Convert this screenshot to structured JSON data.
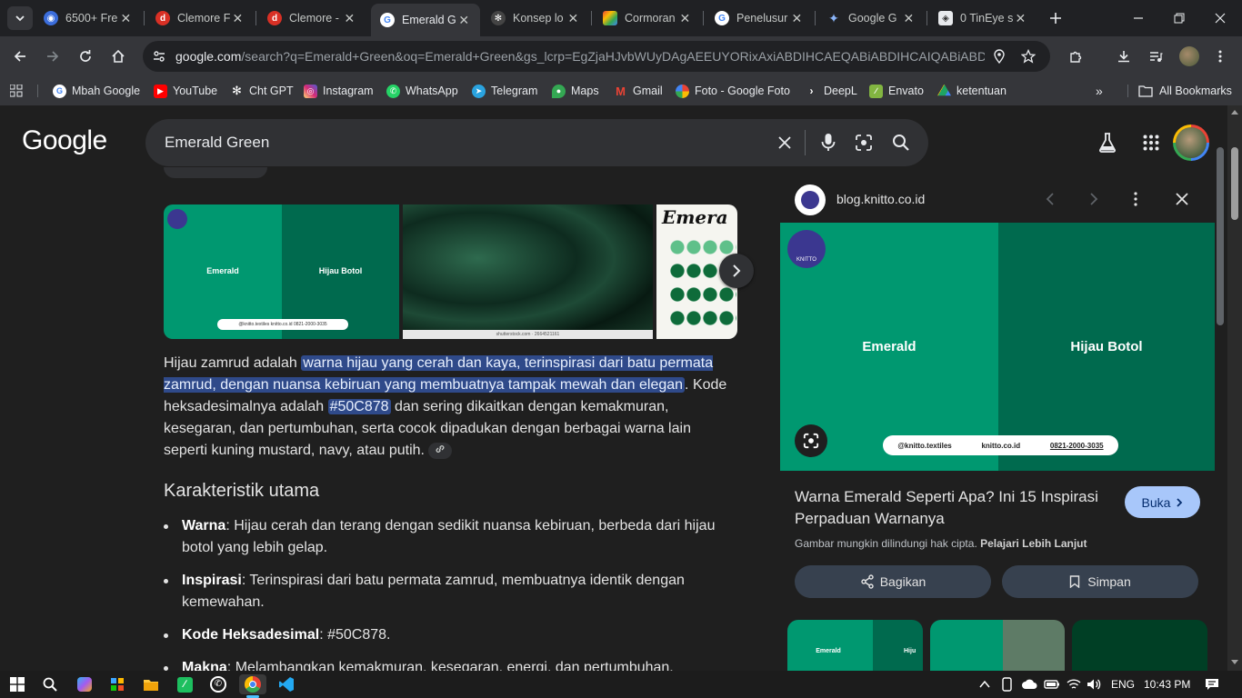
{
  "tabs": [
    {
      "title": "6500+ Fre",
      "favicon": "globe-blue-icon",
      "active": false
    },
    {
      "title": "Clemore F",
      "favicon": "d-red-icon",
      "active": false
    },
    {
      "title": "Clemore -",
      "favicon": "d-red-icon",
      "active": false
    },
    {
      "title": "Emerald G",
      "favicon": "google-icon",
      "active": true
    },
    {
      "title": "Konsep lo",
      "favicon": "chatgpt-icon",
      "active": false
    },
    {
      "title": "Cormoran",
      "favicon": "cormoran-icon",
      "active": false
    },
    {
      "title": "Penelusur",
      "favicon": "google-icon",
      "active": false
    },
    {
      "title": "Google G",
      "favicon": "gemini-icon",
      "active": false
    },
    {
      "title": "0 TinEye s",
      "favicon": "tineye-icon",
      "active": false
    }
  ],
  "omnibox": {
    "url_main": "google.com",
    "url_rest": "/search?q=Emerald+Green&oq=Emerald+Green&gs_lcrp=EgZjaHJvbWUyDAgAEEUYORixAxiABDIHCAEQABiABDIHCAIQABiABDIH..."
  },
  "bookmarks": [
    {
      "label": "Mbah Google",
      "icon": "google-icon",
      "color": "#4285f4"
    },
    {
      "label": "YouTube",
      "icon": "youtube-icon",
      "color": "#ff0000"
    },
    {
      "label": "Cht GPT",
      "icon": "chatgpt-icon",
      "color": "#10a37f"
    },
    {
      "label": "Instagram",
      "icon": "instagram-icon",
      "color": "#d6249f"
    },
    {
      "label": "WhatsApp",
      "icon": "whatsapp-icon",
      "color": "#25d366"
    },
    {
      "label": "Telegram",
      "icon": "telegram-icon",
      "color": "#2aa3df"
    },
    {
      "label": "Maps",
      "icon": "maps-icon",
      "color": "#34a853"
    },
    {
      "label": "Gmail",
      "icon": "gmail-icon",
      "color": "#ea4335"
    },
    {
      "label": "Foto - Google Foto",
      "icon": "photos-icon",
      "color": "#fbbc04"
    },
    {
      "label": "DeepL",
      "icon": "deepl-icon",
      "color": "#0f2b46"
    },
    {
      "label": "Envato",
      "icon": "envato-icon",
      "color": "#82b541"
    },
    {
      "label": "ketentuan",
      "icon": "drive-icon",
      "color": "#1fa463"
    }
  ],
  "all_bookmarks": "All Bookmarks",
  "search": {
    "logo": "Google",
    "query": "Emerald Green"
  },
  "images": {
    "img1_left": "Emerald",
    "img1_right": "Hijau Botol",
    "img1_footer": "@knitto.textiles   knitto.co.id   0821-2000-3035",
    "img2_footer": "shutterstock.com · 2664521161",
    "img3_title": "Emera"
  },
  "answer": {
    "p1": "Hijau zamrud adalah ",
    "p1_hl": "warna hijau yang cerah dan kaya, terinspirasi dari batu permata zamrud, dengan nuansa kebiruan yang membuatnya tampak mewah dan elegan",
    "p2": ". Kode heksadesimalnya adalah ",
    "p2_hl": "#50C878",
    "p3": " dan sering dikaitkan dengan kemakmuran, kesegaran, dan pertumbuhan, serta cocok dipadukan dengan berbagai warna lain seperti kuning mustard, navy, atau putih.",
    "heading": "Karakteristik utama",
    "bullets": [
      {
        "term": "Warna",
        "text": ": Hijau cerah dan terang dengan sedikit nuansa kebiruan, berbeda dari hijau botol yang lebih gelap."
      },
      {
        "term": "Inspirasi",
        "text": ": Terinspirasi dari batu permata zamrud, membuatnya identik dengan kemewahan."
      },
      {
        "term": "Kode Heksadesimal",
        "text": ": #50C878."
      },
      {
        "term": "Makna",
        "text": ": Melambangkan kemakmuran, kesegaran, energi, dan pertumbuhan."
      }
    ]
  },
  "side_panel": {
    "source": "blog.knitto.co.id",
    "image_left": "Emerald",
    "image_right": "Hijau Botol",
    "footer_ig": "@knitto.textiles",
    "footer_web": "knitto.co.id",
    "footer_phone": "0821-2000-3035",
    "logo_text": "KNITTO",
    "title": "Warna Emerald Seperti Apa? Ini 15 Inspirasi Perpaduan Warnanya",
    "open_btn": "Buka",
    "copyright": "Gambar mungkin dilindungi hak cipta. ",
    "learn_more": "Pelajari Lebih Lanjut",
    "share_btn": "Bagikan",
    "save_btn": "Simpan",
    "related_left": "Emerald",
    "related_right": "Hiju"
  },
  "colors": {
    "emerald": "#009870",
    "bottle_green": "#006a4e",
    "highlight": "#2f4a8a"
  },
  "taskbar": {
    "lang": "ENG",
    "time": "10:43 PM"
  }
}
